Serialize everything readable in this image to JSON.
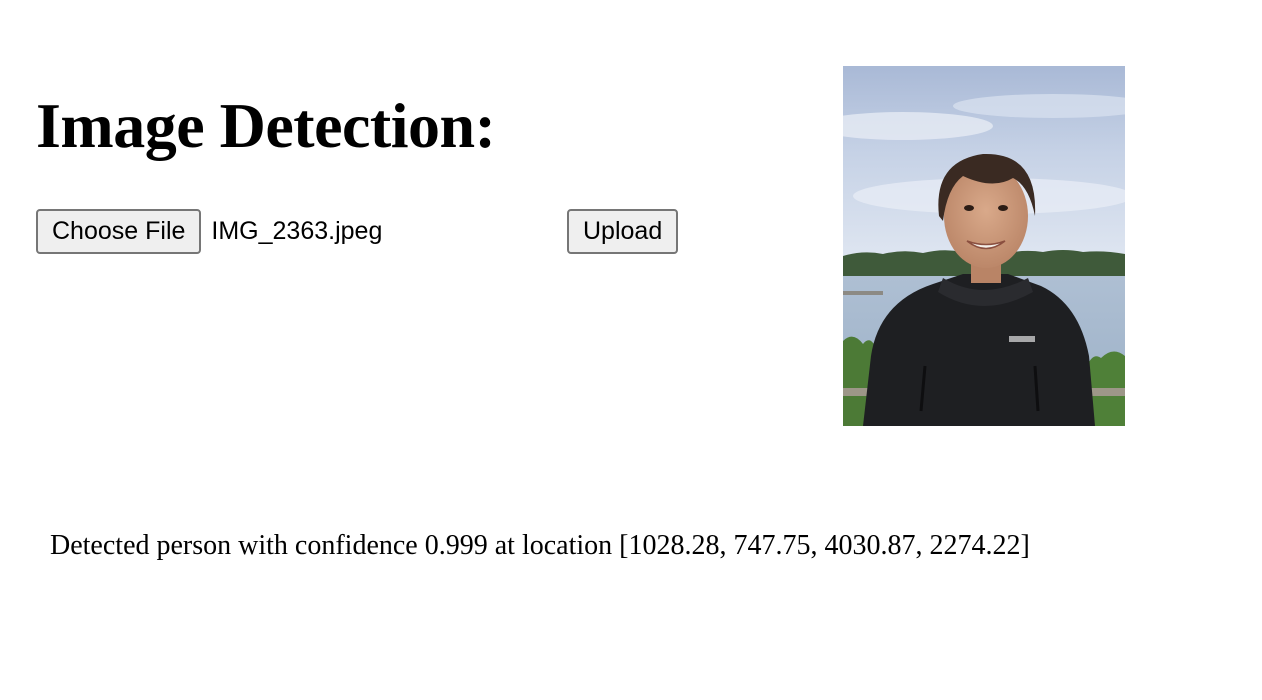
{
  "page": {
    "title": "Image Detection:"
  },
  "file_input": {
    "choose_label": "Choose File",
    "file_name": "IMG_2363.jpeg"
  },
  "upload": {
    "label": "Upload"
  },
  "result": {
    "text": "Detected person with confidence 0.999 at location [1028.28, 747.75, 4030.87, 2274.22]"
  },
  "colors": {
    "button_bg": "#efefef",
    "button_border": "#767676",
    "text": "#000000",
    "background": "#ffffff"
  }
}
